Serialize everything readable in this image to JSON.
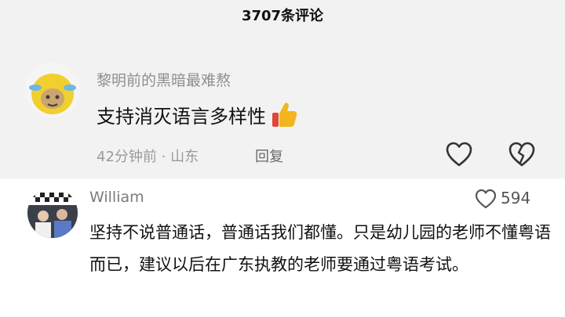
{
  "header": {
    "title": "3707条评论"
  },
  "comment1": {
    "username": "黎明前的黑暗最难熬",
    "text": "支持消灭语言多样性",
    "emoji": "thumbs-up-icon",
    "meta": "42分钟前 · 山东",
    "reply_label": "回复"
  },
  "comment2": {
    "username": "William",
    "like_count": "594",
    "text": "坚持不说普通话，普通话我们都懂。只是幼儿园的老师不懂粤语而已，建议以后在广东执教的老师要通过粤语考试。"
  },
  "colors": {
    "top_panel_bg": "#f2f2f2",
    "thumb_yellow": "#f2b51d",
    "thumb_red": "#e0453a"
  }
}
